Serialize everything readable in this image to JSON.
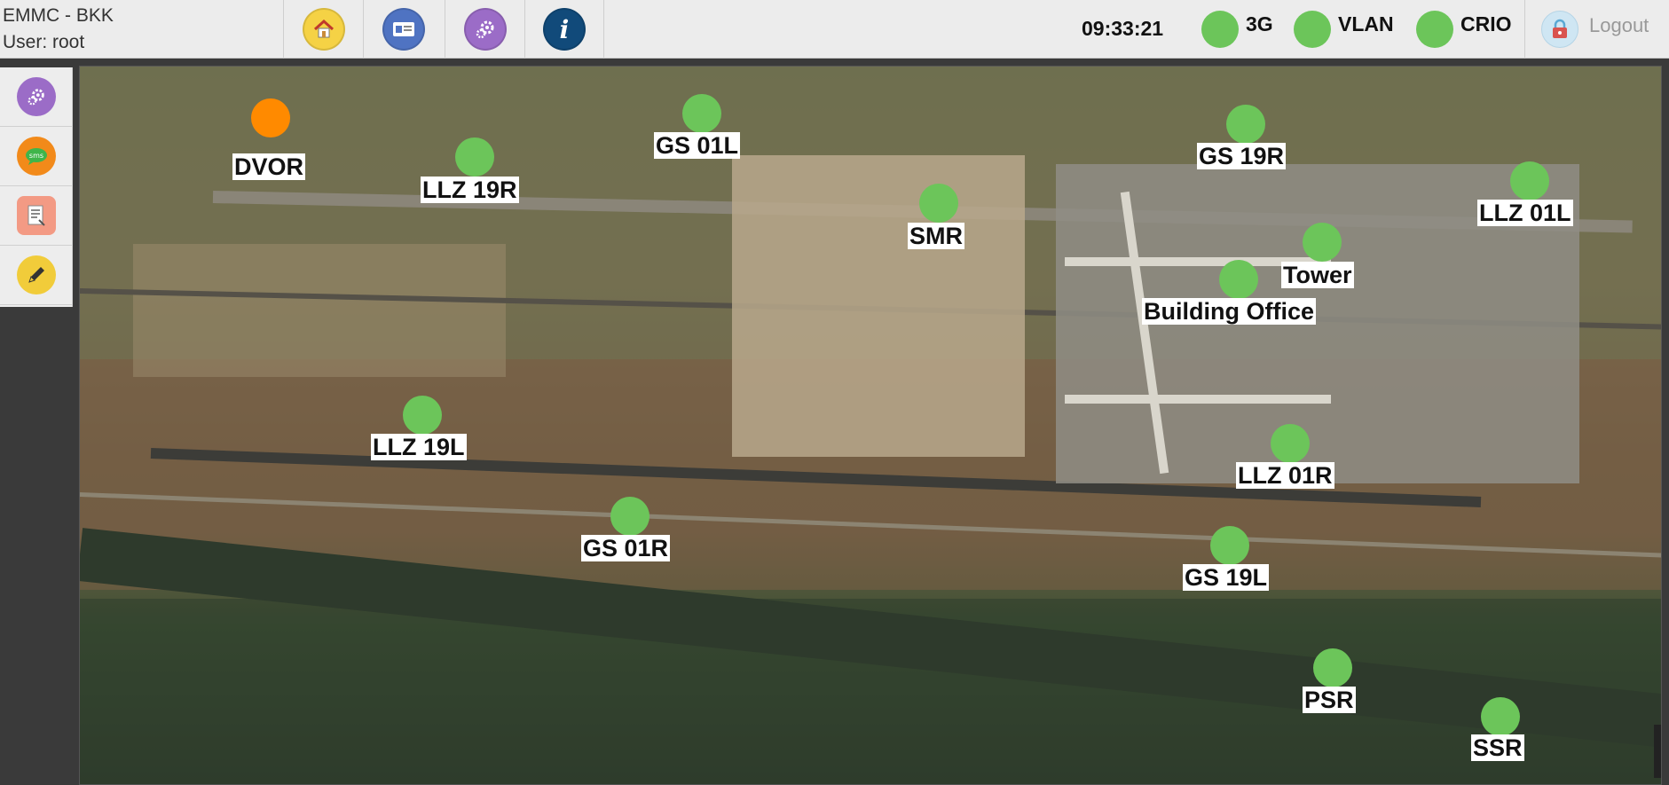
{
  "header": {
    "app_title": "EMMC - BKK",
    "user_line": "User: root",
    "clock": "09:33:21",
    "nav": [
      {
        "icon": "home-icon",
        "color": "#f5d245"
      },
      {
        "icon": "id-card-icon",
        "color": "#4f73c2"
      },
      {
        "icon": "gears-icon",
        "color": "#9b6cc7"
      },
      {
        "icon": "info-icon",
        "color": "#114a7a"
      }
    ],
    "statuses": [
      {
        "label": "3G",
        "color": "#6cc55a"
      },
      {
        "label": "VLAN",
        "color": "#6cc55a"
      },
      {
        "label": "CRIO",
        "color": "#6cc55a"
      }
    ],
    "logout_label": "Logout"
  },
  "sidebar": [
    {
      "icon": "gears-icon",
      "color": "#9b6cc7"
    },
    {
      "icon": "sms-icon",
      "color": "#f28a1a"
    },
    {
      "icon": "report-icon",
      "color": "#f39a84"
    },
    {
      "icon": "pencil-icon",
      "color": "#f1cc3a"
    }
  ],
  "map": {
    "stations": [
      {
        "name": "DVOR",
        "status": "warning",
        "color": "#ff8a00"
      },
      {
        "name": "GS 01L",
        "status": "ok",
        "color": "#6cc55a"
      },
      {
        "name": "LLZ 19R",
        "status": "ok",
        "color": "#6cc55a"
      },
      {
        "name": "GS 19R",
        "status": "ok",
        "color": "#6cc55a"
      },
      {
        "name": "LLZ 01L",
        "status": "ok",
        "color": "#6cc55a"
      },
      {
        "name": "SMR",
        "status": "ok",
        "color": "#6cc55a"
      },
      {
        "name": "Tower",
        "status": "ok",
        "color": "#6cc55a"
      },
      {
        "name": "Building Office",
        "status": "ok",
        "color": "#6cc55a"
      },
      {
        "name": "LLZ 19L",
        "status": "ok",
        "color": "#6cc55a"
      },
      {
        "name": "LLZ 01R",
        "status": "ok",
        "color": "#6cc55a"
      },
      {
        "name": "GS 01R",
        "status": "ok",
        "color": "#6cc55a"
      },
      {
        "name": "GS 19L",
        "status": "ok",
        "color": "#6cc55a"
      },
      {
        "name": "PSR",
        "status": "ok",
        "color": "#6cc55a"
      },
      {
        "name": "SSR",
        "status": "ok",
        "color": "#6cc55a"
      }
    ]
  }
}
